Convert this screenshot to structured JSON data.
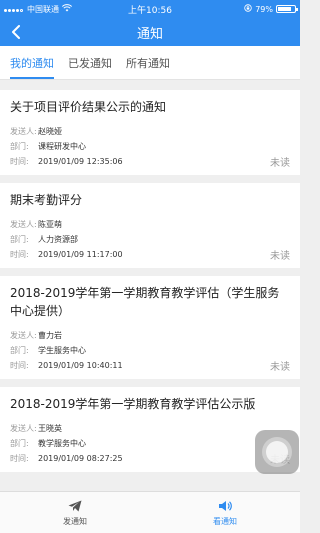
{
  "status_bar": {
    "carrier": "中国联通",
    "time": "上午10:56",
    "battery": "79%",
    "battery_level": 0.79
  },
  "navbar": {
    "title": "通知"
  },
  "tabs": [
    {
      "label": "我的通知",
      "active": true
    },
    {
      "label": "已发通知",
      "active": false
    },
    {
      "label": "所有通知",
      "active": false
    }
  ],
  "labels": {
    "sender": "发送人:",
    "department": "部门:",
    "time": "时间:"
  },
  "notices": [
    {
      "title": "关于项目评价结果公示的通知",
      "sender": "赵晓娅",
      "department": "课程研发中心",
      "time": "2019/01/09 12:35:06",
      "status": "未读"
    },
    {
      "title": "期末考勤评分",
      "sender": "陈亚萌",
      "department": "人力资源部",
      "time": "2019/01/09 11:17:00",
      "status": "未读"
    },
    {
      "title": "2018-2019学年第一学期教育教学评估（学生服务中心提供）",
      "sender": "曹力岩",
      "department": "学生服务中心",
      "time": "2019/01/09 10:40:11",
      "status": "未读"
    },
    {
      "title": "2018-2019学年第一学期教育教学评估公示版",
      "sender": "王晓英",
      "department": "教学服务中心",
      "time": "2019/01/09 08:27:25",
      "status": "未读"
    }
  ],
  "bottom_bar": [
    {
      "label": "发通知",
      "icon": "send-icon",
      "active": false
    },
    {
      "label": "看通知",
      "icon": "speaker-icon",
      "active": true
    }
  ],
  "colors": {
    "primary": "#2f8cf0",
    "background": "#efefef"
  }
}
